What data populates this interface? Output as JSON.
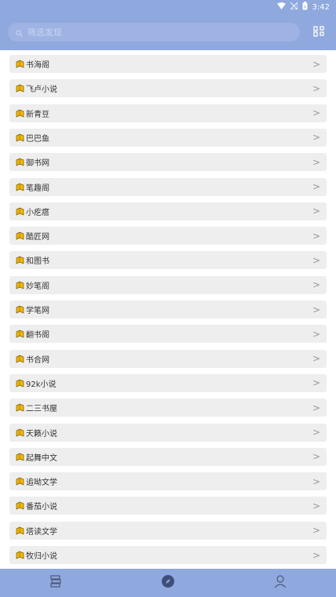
{
  "status": {
    "time": "3:42",
    "icons": [
      "wifi-icon",
      "signal-icon",
      "battery-icon"
    ]
  },
  "search": {
    "placeholder": "筛选发现",
    "icon": "search-icon"
  },
  "scan": {
    "icon": "qr-scan-icon"
  },
  "items": [
    {
      "label": "书海阁"
    },
    {
      "label": "飞卢小说"
    },
    {
      "label": "新青豆"
    },
    {
      "label": "巴巴鱼"
    },
    {
      "label": "御书网"
    },
    {
      "label": "笔趣阁"
    },
    {
      "label": "小疙瘩"
    },
    {
      "label": "酷匠网"
    },
    {
      "label": "和图书"
    },
    {
      "label": "妙笔阁"
    },
    {
      "label": "学笔网"
    },
    {
      "label": "翻书阁"
    },
    {
      "label": "书合网"
    },
    {
      "label": "92k小说"
    },
    {
      "label": "二三书屋"
    },
    {
      "label": "天籁小说"
    },
    {
      "label": "起舞中文"
    },
    {
      "label": "追呦文学"
    },
    {
      "label": "番茄小说"
    },
    {
      "label": "塔读文学"
    },
    {
      "label": "牧归小说"
    }
  ],
  "chevron": ">",
  "bottom_tabs": [
    {
      "icon": "bookshelf-icon"
    },
    {
      "icon": "compass-icon"
    },
    {
      "icon": "person-icon"
    }
  ],
  "colors": {
    "bar": "#8fa8de",
    "item_bg": "#eeeeee",
    "book_icon": "#f2b705"
  }
}
